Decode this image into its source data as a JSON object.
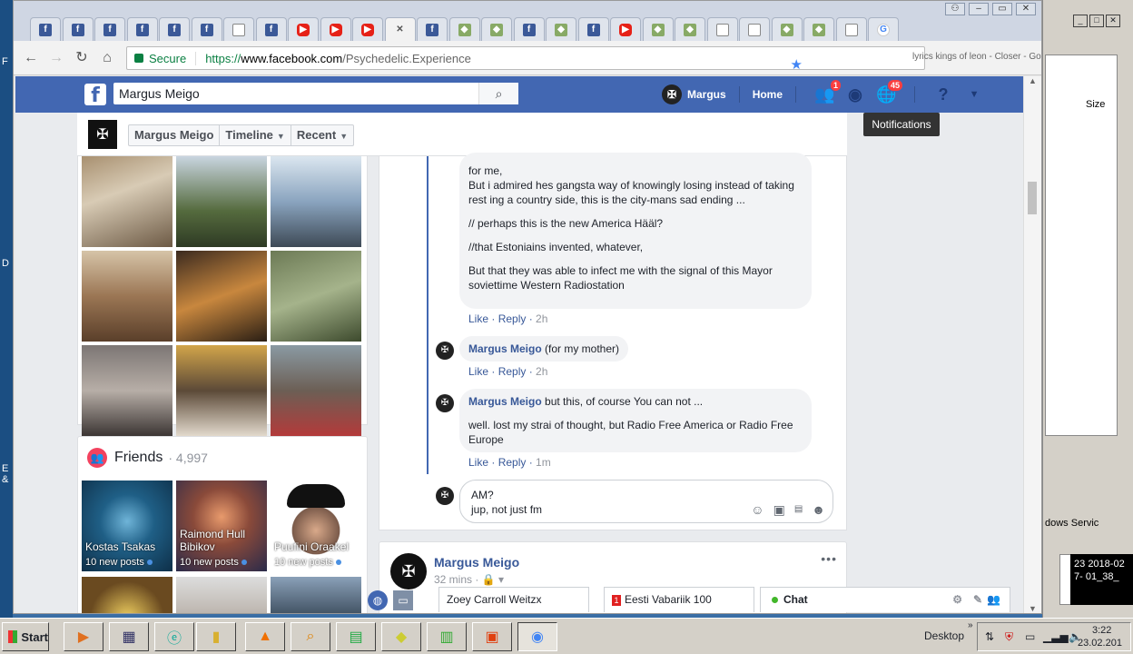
{
  "browser": {
    "tab_icons": [
      "fb",
      "fb",
      "fb",
      "fb",
      "fb",
      "fb",
      "doc",
      "fb",
      "yt",
      "yt",
      "yt",
      "close",
      "fb",
      "misc",
      "misc",
      "fb",
      "misc",
      "fb",
      "yt",
      "misc",
      "misc",
      "doc",
      "doc",
      "misc",
      "misc",
      "doc",
      "g"
    ],
    "omnibox": {
      "secure_label": "Secure",
      "url_scheme": "https://",
      "url_host": "www.facebook.com",
      "url_path": "/Psychedelic.Experience"
    },
    "lyrics_tab_text": "lyrics kings of leon - Closer - Google Search"
  },
  "fb": {
    "search_value": "Margus Meigo",
    "nav": {
      "profile_name": "Margus",
      "home_label": "Home",
      "friend_requests_badge": "1",
      "notifications_badge": "45"
    },
    "tooltip": "Notifications",
    "subnav": {
      "name": "Margus Meigo",
      "timeline": "Timeline",
      "recent": "Recent"
    },
    "friends": {
      "title": "Friends",
      "count": "· 4,997",
      "items": [
        {
          "name": "Kostas Tsakas",
          "posts": "10 new posts"
        },
        {
          "name": "Raimond Hull Bibikov",
          "posts": "10 new posts"
        },
        {
          "name": "Puufini Oraakel",
          "posts": "10 new posts"
        }
      ]
    },
    "comments": {
      "first": {
        "lines": [
          "for me,",
          "But i admired hes gangsta way of knowingly losing instead of taking rest ing a country side, this is the city-mans sad ending ...",
          "// perhaps this is the new America Hääl?",
          "//that Estoniains invented, whatever,",
          "But that they was able to infect me with the signal of this Mayor soviettime Western Radiostation"
        ],
        "like": "Like",
        "reply": "Reply",
        "time": "2h"
      },
      "second": {
        "author": "Margus Meigo",
        "text": "(for my mother)",
        "like": "Like",
        "reply": "Reply",
        "time": "2h"
      },
      "third": {
        "author": "Margus Meigo",
        "text": "but this, of course You can not ...",
        "text2": "well. lost my strai of thought, but Radio Free America or Radio Free Europe",
        "like": "Like",
        "reply": "Reply",
        "time": "1m"
      },
      "reply_box": {
        "line1": "AM?",
        "line2": "jup, not just fm"
      }
    },
    "post": {
      "author": "Margus Meigo",
      "time": "32 mins ·"
    },
    "chat": {
      "tab1": "Zoey Carroll Weitzx",
      "tab2_badge": "1",
      "tab2": "Eesti Vabariik 100",
      "main": "Chat"
    }
  },
  "desktop": {
    "right_window_size_label": "Size",
    "right_window_service": "dows Servic",
    "clock_date_a": "2018-02",
    "clock_date_b": "01_38_",
    "clock_num": "23",
    "clock_num2": "7-"
  },
  "taskbar": {
    "start": "Start",
    "desktop": "Desktop",
    "time": "3:22",
    "date": "23.02.201"
  }
}
